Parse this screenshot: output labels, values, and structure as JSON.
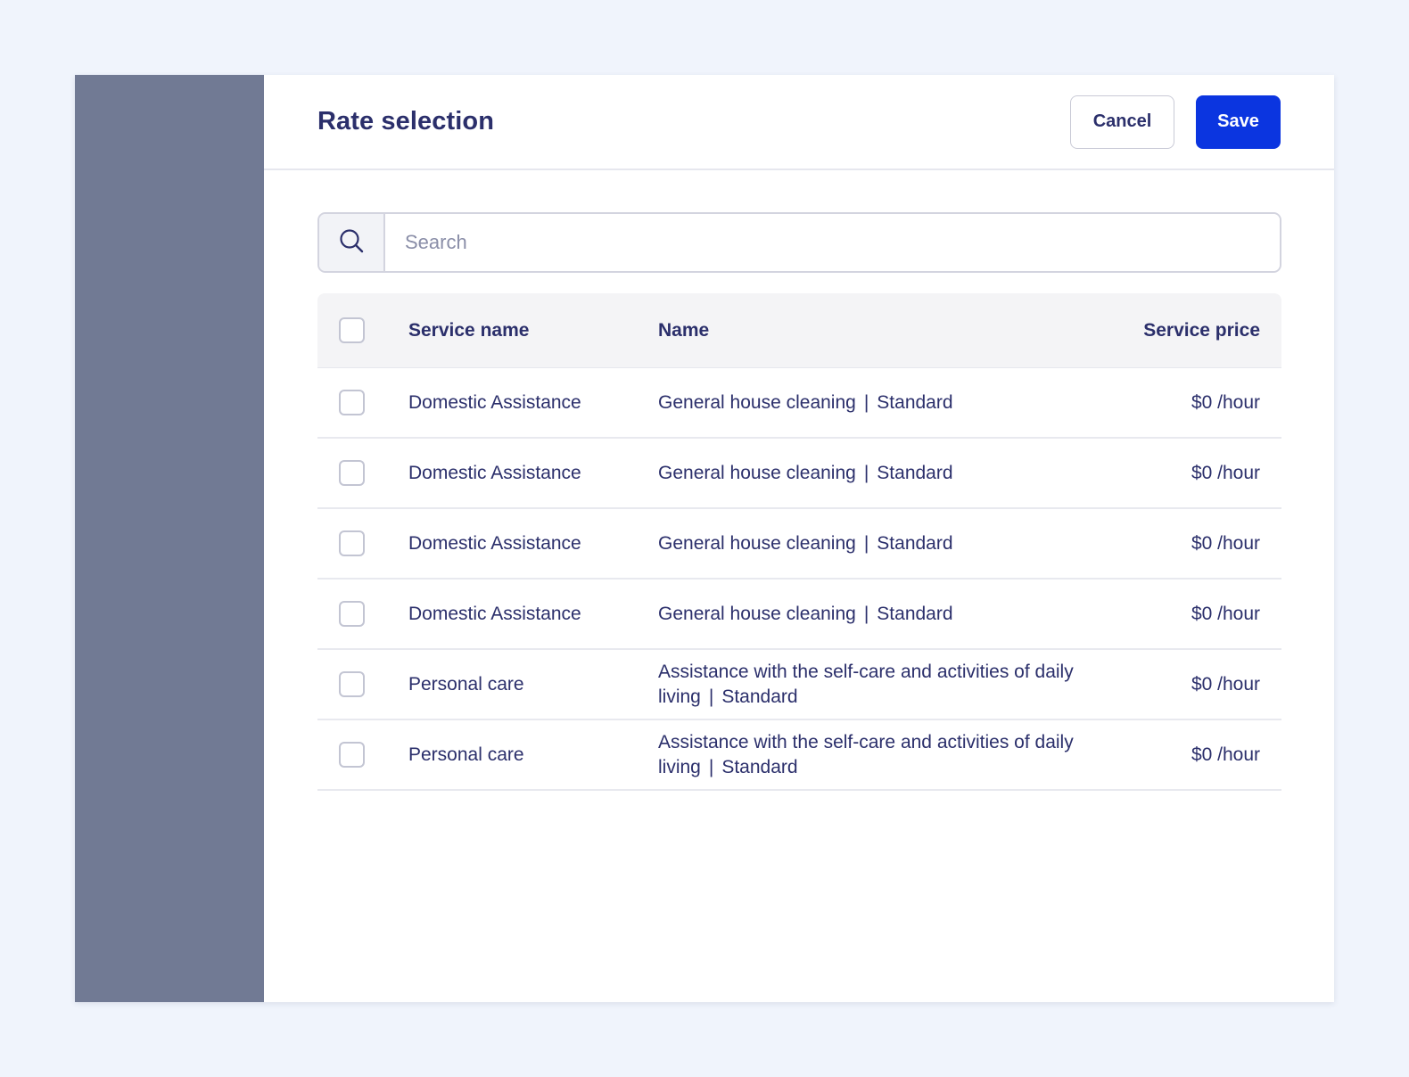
{
  "modal": {
    "title": "Rate selection",
    "cancel_label": "Cancel",
    "save_label": "Save"
  },
  "search": {
    "placeholder": "Search",
    "icon": "search-icon"
  },
  "table": {
    "columns": {
      "service_name": "Service name",
      "name": "Name",
      "service_price": "Service price"
    },
    "separator": "|",
    "rows": [
      {
        "service_name": "Domestic Assistance",
        "name": "General house cleaning",
        "tier": "Standard",
        "price": "$0 /hour",
        "checked": false
      },
      {
        "service_name": "Domestic Assistance",
        "name": "General house cleaning",
        "tier": "Standard",
        "price": "$0 /hour",
        "checked": false
      },
      {
        "service_name": "Domestic Assistance",
        "name": "General house cleaning",
        "tier": "Standard",
        "price": "$0 /hour",
        "checked": false
      },
      {
        "service_name": "Domestic Assistance",
        "name": "General house cleaning",
        "tier": "Standard",
        "price": "$0 /hour",
        "checked": false
      },
      {
        "service_name": "Personal care",
        "name": "Assistance with the self-care and activities of daily living",
        "tier": "Standard",
        "price": "$0 /hour",
        "checked": false
      },
      {
        "service_name": "Personal care",
        "name": "Assistance with the self-care and activities of daily living",
        "tier": "Standard",
        "price": "$0 /hour",
        "checked": false
      }
    ]
  },
  "colors": {
    "page_background": "#f0f4fc",
    "sidebar": "#717a94",
    "primary": "#0b35e0",
    "text": "#2b2f6b"
  }
}
